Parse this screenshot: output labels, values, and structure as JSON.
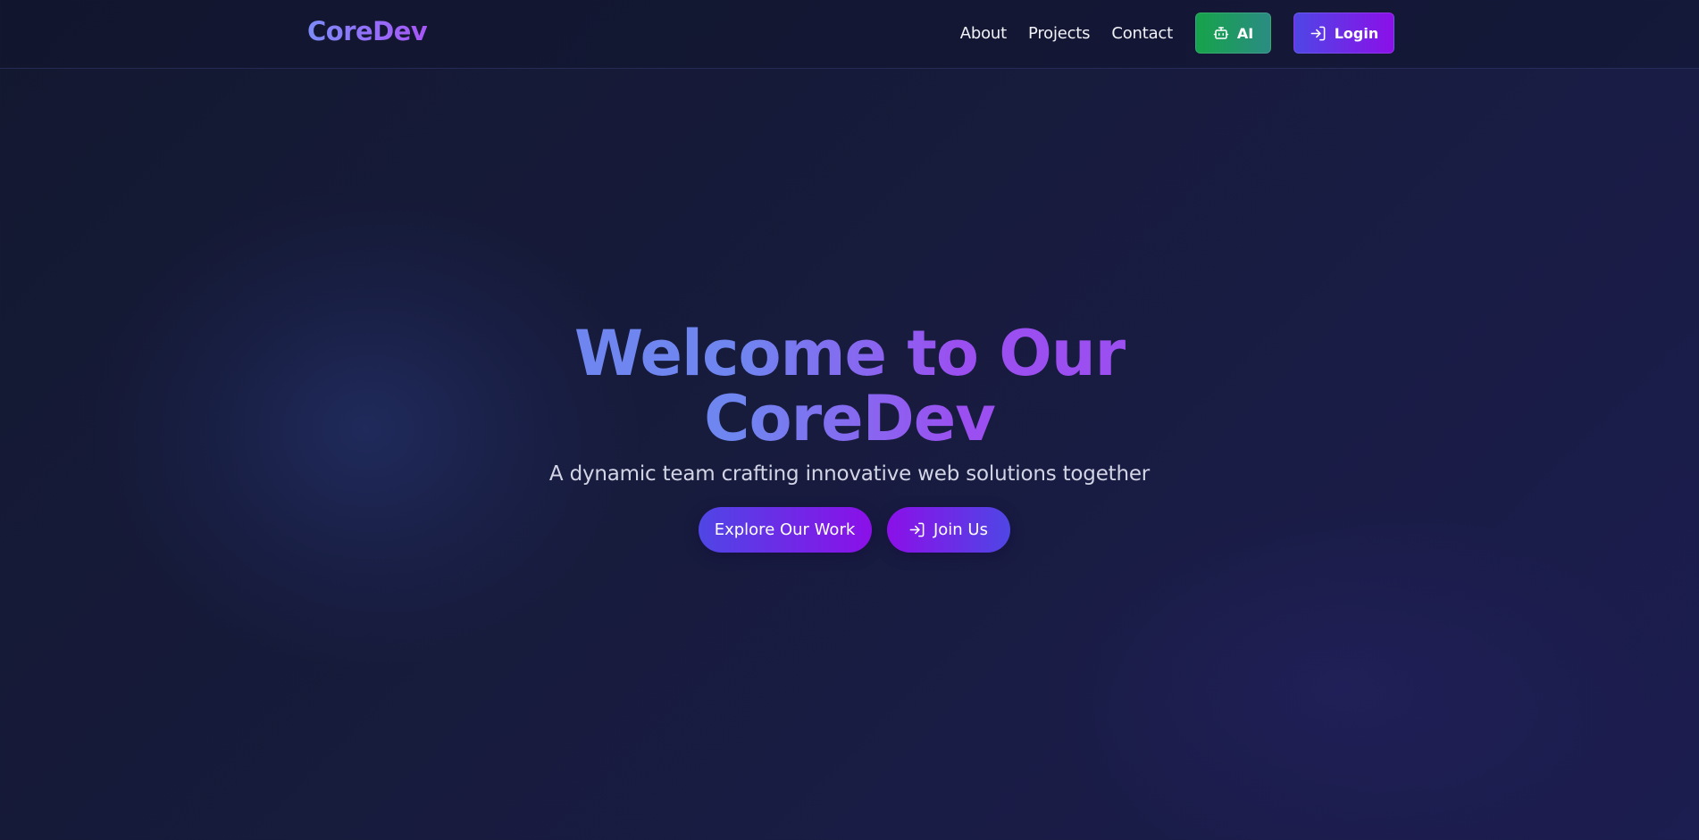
{
  "header": {
    "logo": "CoreDev",
    "nav": {
      "about": "About",
      "projects": "Projects",
      "contact": "Contact"
    },
    "ai_button": {
      "label": "AI",
      "icon": "robot-icon"
    },
    "login_button": {
      "label": "Login",
      "icon": "login-icon"
    }
  },
  "hero": {
    "title_line1": "Welcome to Our",
    "title_line2": "CoreDev",
    "subtitle": "A dynamic team crafting innovative web solutions together",
    "explore_button": "Explore Our Work",
    "join_button": {
      "label": "Join Us",
      "icon": "login-icon"
    }
  },
  "colors": {
    "background_start": "#131830",
    "background_end": "#1c1d50",
    "accent_indigo": "#4f46e5",
    "accent_purple": "#8b10e8",
    "ai_green": "#16a34a",
    "gradient_text_start": "#7c8cf8",
    "gradient_text_end": "#a855f7"
  }
}
